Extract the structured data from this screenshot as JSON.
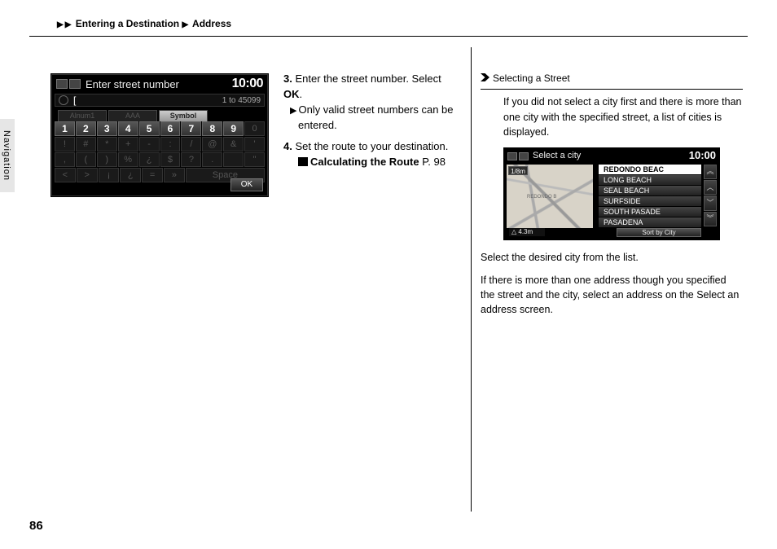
{
  "breadcrumb": {
    "tri": "▶",
    "seg1": "Entering a Destination",
    "seg2": "Address"
  },
  "sidetab": "Navigation",
  "scr1": {
    "title": "Enter street number",
    "clock": "10:00",
    "input_value": "[",
    "range": "1 to 45099",
    "tabs": [
      "Alnum1",
      "AAA",
      "Symbol"
    ],
    "row1": [
      "1",
      "2",
      "3",
      "4",
      "5",
      "6",
      "7",
      "8",
      "9",
      "0"
    ],
    "row2": [
      "!",
      "#",
      "*",
      "+",
      "-",
      ":",
      "/",
      "@",
      "&",
      "'"
    ],
    "row3": [
      ",",
      "(",
      ")",
      "%",
      "¿",
      "$",
      "?",
      ".",
      "",
      "\""
    ],
    "row4": [
      "<",
      ">",
      "¡",
      "¿",
      "=",
      "»"
    ],
    "space": "Space",
    "ok": "OK"
  },
  "steps": {
    "s3_num": "3.",
    "s3_text_a": "Enter the street number. Select ",
    "s3_ok": "OK",
    "s3_text_b": ".",
    "s3_sub": "Only valid street numbers can be entered.",
    "s4_num": "4.",
    "s4_text": "Set the route to your destination.",
    "xref_label": "Calculating the Route",
    "xref_page": "P. 98",
    "tri": "▶"
  },
  "right": {
    "heading": "Selecting a Street",
    "p1": "If you did not select a city first and there is more than one city with the specified street, a list of cities is displayed.",
    "scr2": {
      "title": "Select a city",
      "clock": "10:00",
      "scale": "1/8m",
      "maplabel": "REDONDO B",
      "dist": "△ 4.3m",
      "items": [
        "REDONDO BEAC",
        "LONG BEACH",
        "SEAL BEACH",
        "SURFSIDE",
        "SOUTH PASADE",
        "PASADENA"
      ],
      "sort": "Sort by City",
      "scroll": [
        "︽",
        "︿",
        "﹀",
        "︾"
      ]
    },
    "p2": "Select the desired city from the list.",
    "p3": "If there is more than one address though you specified the street and the city, select an address on the Select an address screen."
  },
  "pagenum": "86"
}
